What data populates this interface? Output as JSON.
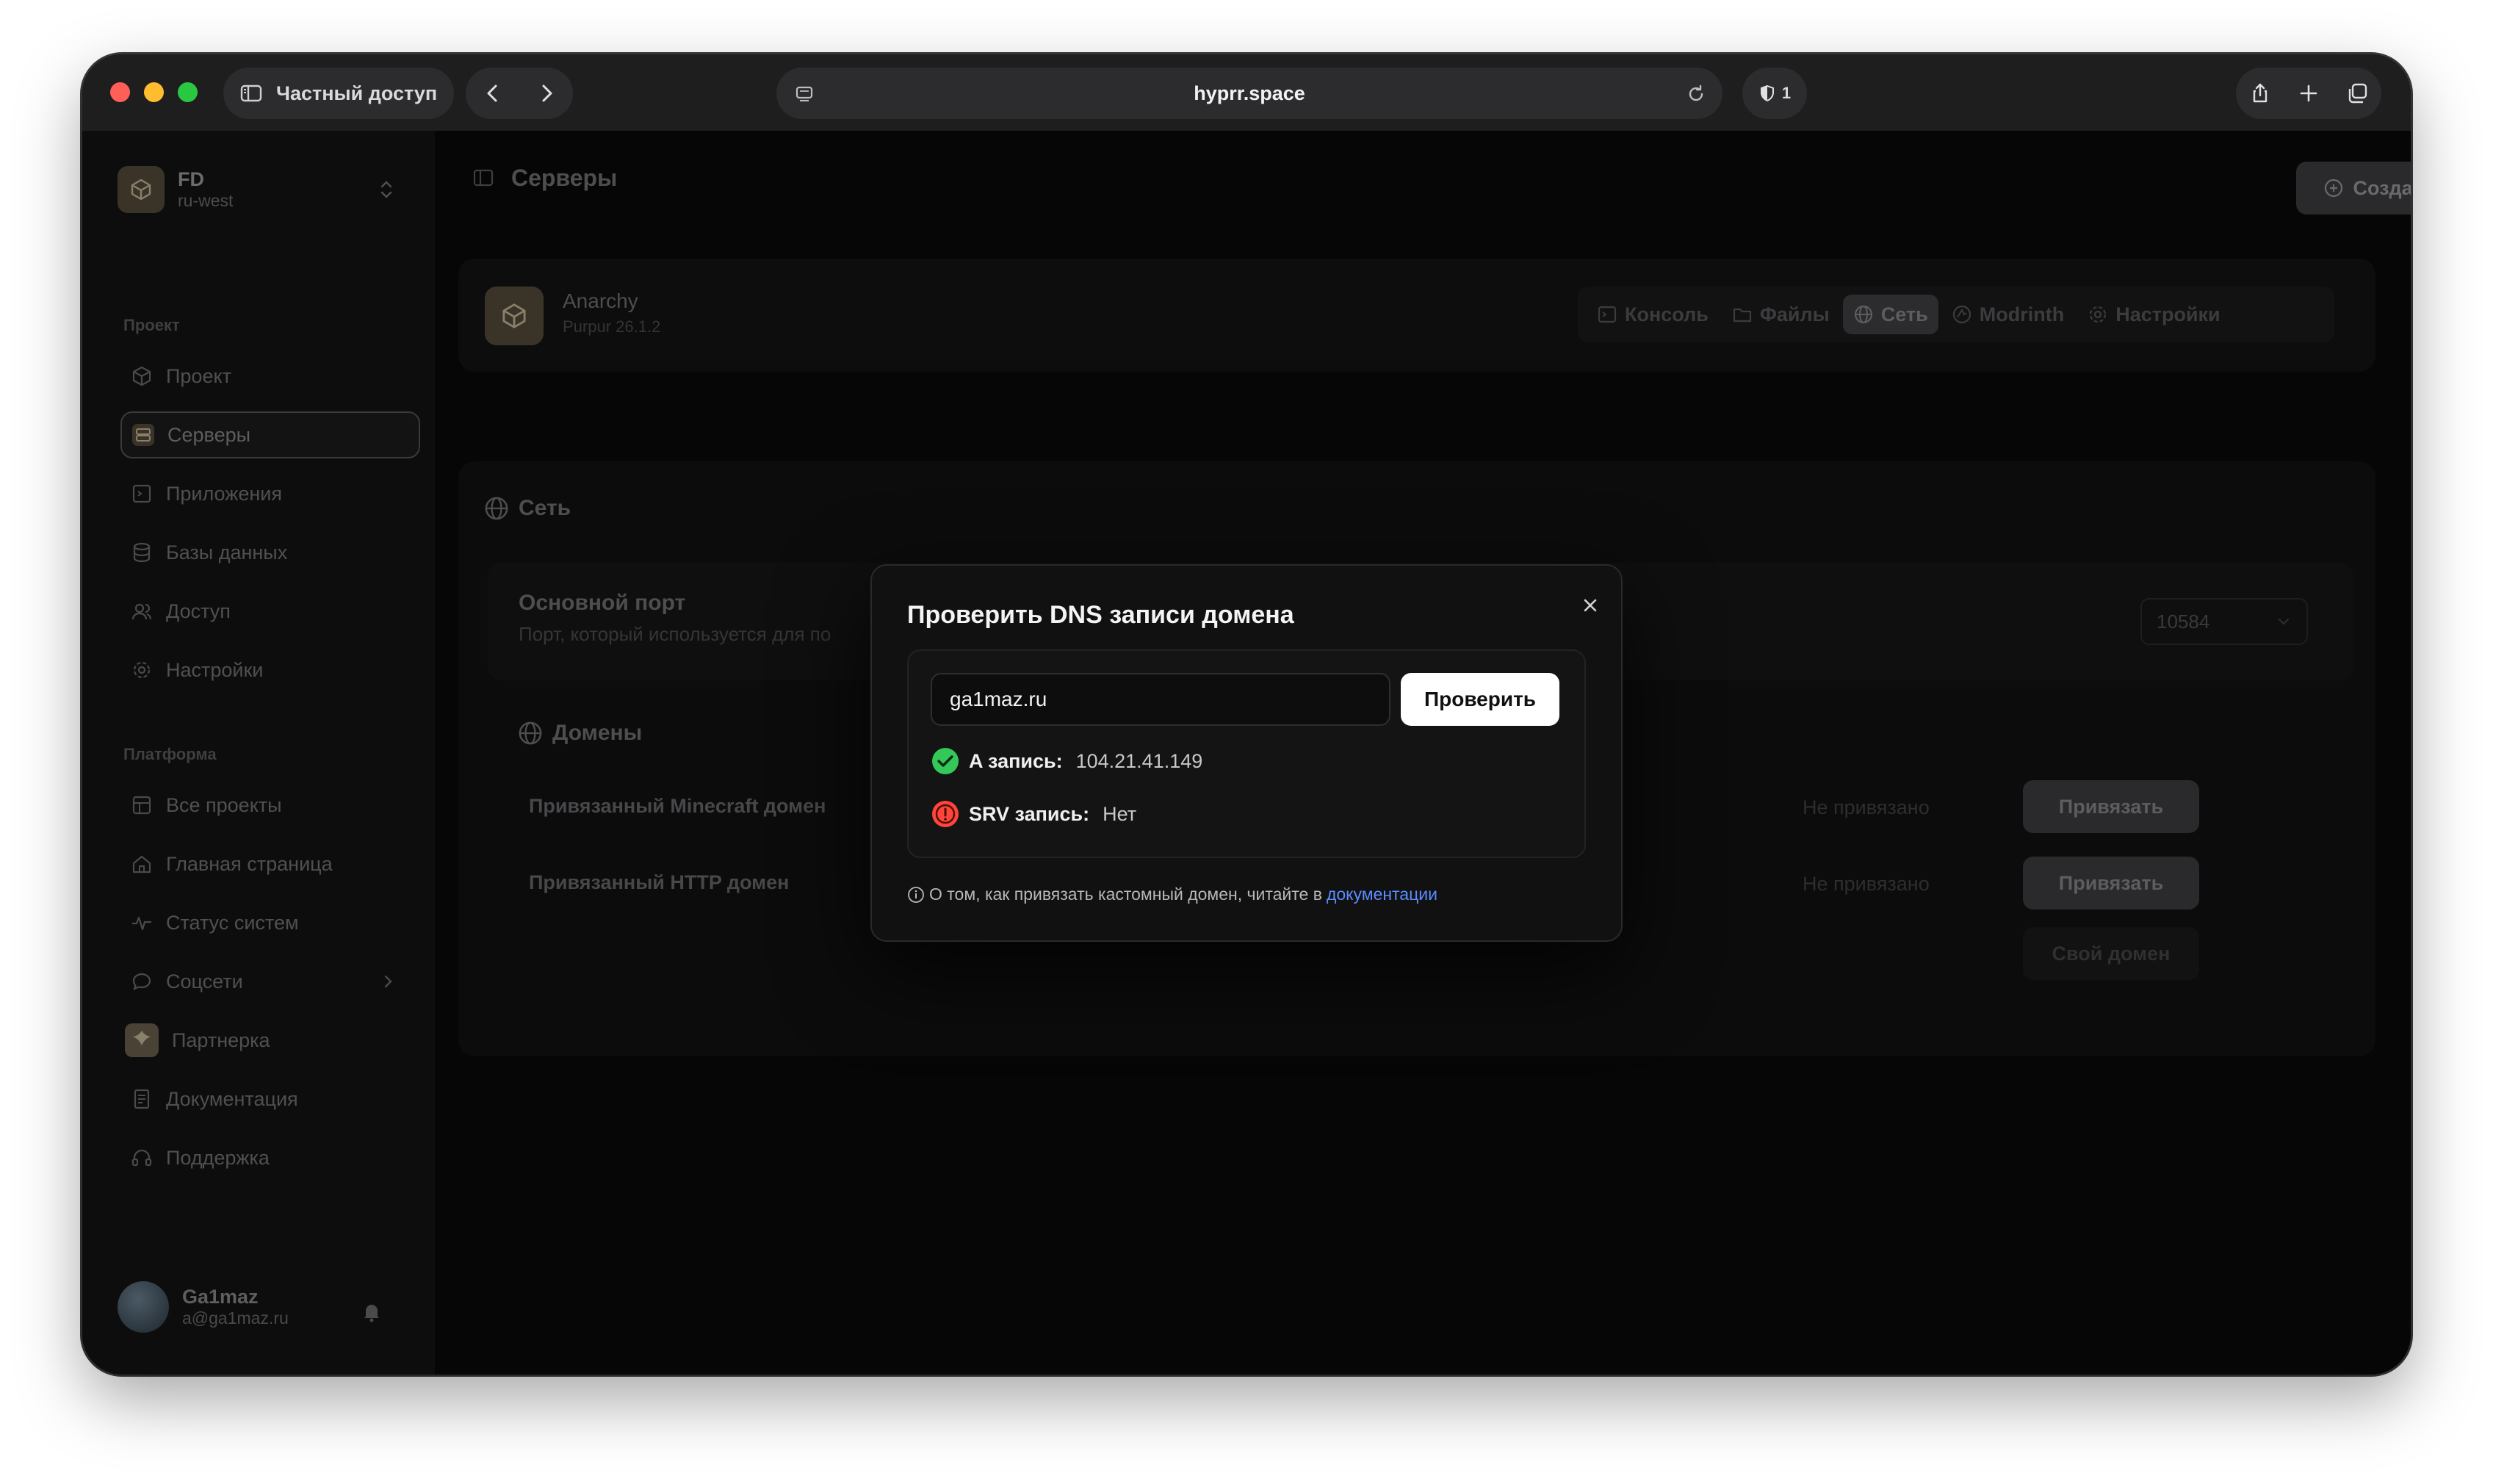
{
  "browser": {
    "private_label": "Частный доступ",
    "url": "hyprr.space",
    "shield_count": "1"
  },
  "sidebar": {
    "team_name": "FD",
    "team_region": "ru-west",
    "section_project": "Проект",
    "project_items": [
      {
        "label": "Проект",
        "icon": "cube-icon"
      },
      {
        "label": "Серверы",
        "icon": "server-icon"
      },
      {
        "label": "Приложения",
        "icon": "app-icon"
      },
      {
        "label": "Базы данных",
        "icon": "database-icon"
      },
      {
        "label": "Доступ",
        "icon": "users-icon"
      },
      {
        "label": "Настройки",
        "icon": "gear-icon"
      }
    ],
    "section_platform": "Платформа",
    "platform_items": [
      {
        "label": "Все проекты",
        "icon": "grid-icon"
      },
      {
        "label": "Главная страница",
        "icon": "home-icon"
      },
      {
        "label": "Статус систем",
        "icon": "pulse-icon"
      },
      {
        "label": "Соцсети",
        "icon": "chat-icon"
      },
      {
        "label": "Партнерка",
        "icon": "partner-icon"
      },
      {
        "label": "Документация",
        "icon": "doc-icon"
      },
      {
        "label": "Поддержка",
        "icon": "headset-icon"
      }
    ],
    "user_name": "Ga1maz",
    "user_email": "a@ga1maz.ru"
  },
  "main": {
    "page_title": "Серверы",
    "create_label": "Создать",
    "server_name": "Anarchy",
    "server_sub": "Purpur 26.1.2",
    "tabs": [
      {
        "label": "Консоль",
        "icon": "terminal-icon"
      },
      {
        "label": "Файлы",
        "icon": "folder-icon"
      },
      {
        "label": "Сеть",
        "icon": "globe-icon"
      },
      {
        "label": "Modrinth",
        "icon": "modrinth-icon"
      },
      {
        "label": "Настройки",
        "icon": "gear-icon"
      }
    ],
    "network_title": "Сеть",
    "port_title": "Основной порт",
    "port_desc": "Порт, который используется для по",
    "port_value": "10584",
    "domains_title": "Домены",
    "domains": [
      {
        "label": "Привязанный Minecraft домен",
        "status": "Не привязано",
        "button": "Привязать"
      },
      {
        "label": "Привязанный HTTP домен",
        "status": "Не привязано",
        "button": "Привязать"
      }
    ],
    "own_domain_label": "Свой домен"
  },
  "dialog": {
    "title": "Проверить DNS записи домена",
    "input_value": "ga1maz.ru",
    "check_label": "Проверить",
    "records": [
      {
        "label": "A запись:",
        "value": "104.21.41.149",
        "status": "ok",
        "color": "#34c759"
      },
      {
        "label": "SRV запись:",
        "value": "Нет",
        "status": "error",
        "color": "#ff453a"
      }
    ],
    "footer_text": "О том, как привязать кастомный домен, читайте в",
    "footer_link": "документации"
  },
  "colors": {
    "accent_link": "#5b8cff",
    "ok": "#34c759",
    "error": "#ff453a"
  }
}
